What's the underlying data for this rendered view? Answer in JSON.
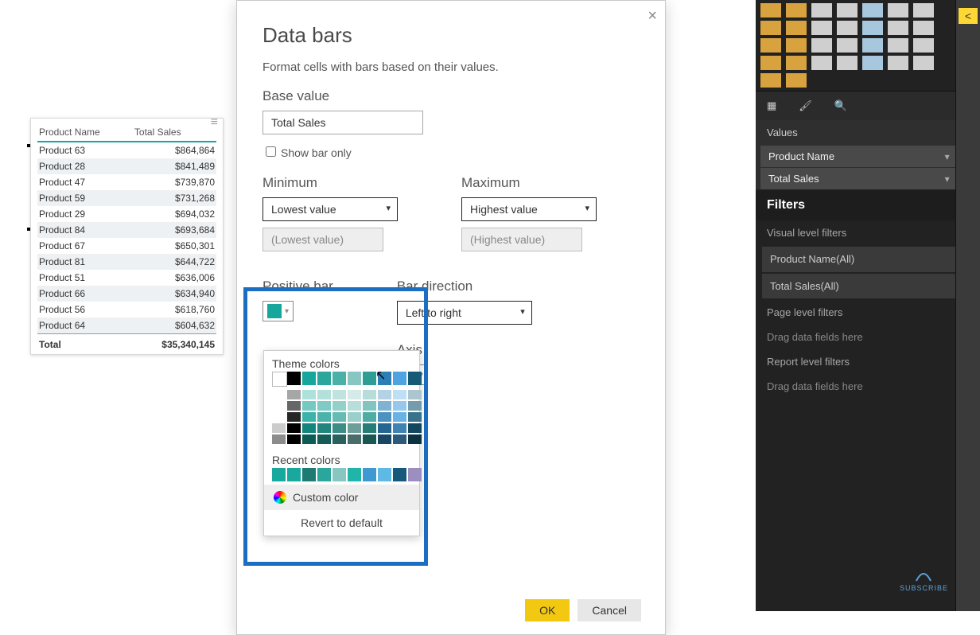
{
  "dialog": {
    "title": "Data bars",
    "subtitle": "Format cells with bars based on their values.",
    "base_value_label": "Base value",
    "base_value": "Total Sales",
    "show_bar_only": "Show bar only",
    "minimum_label": "Minimum",
    "minimum_sel": "Lowest value",
    "minimum_ph": "(Lowest value)",
    "maximum_label": "Maximum",
    "maximum_sel": "Highest value",
    "maximum_ph": "(Highest value)",
    "positive_label": "Positive bar",
    "positive_color": "#17a69b",
    "direction_label": "Bar direction",
    "direction_sel": "Left to right",
    "axis_label": "Axis",
    "axis_color": "#000000",
    "ok": "OK",
    "cancel": "Cancel"
  },
  "color_picker": {
    "theme_label": "Theme colors",
    "recent_label": "Recent colors",
    "custom": "Custom color",
    "revert": "Revert to default",
    "theme_row": [
      "#ffffff",
      "#000000",
      "#17a69b",
      "#2aa69c",
      "#4bb0a7",
      "#88c7c1",
      "#2e9e94",
      "#2b7fb5",
      "#4ea4e0",
      "#155a77"
    ],
    "recent_row": [
      "#19a89d",
      "#19a89d",
      "#1e7a72",
      "#2aa69c",
      "#88c7c1",
      "#1fb5a8",
      "#3f99d1",
      "#5fb9e5",
      "#16597a",
      "#9c8fbf"
    ]
  },
  "table": {
    "cols": [
      "Product Name",
      "Total Sales"
    ],
    "rows": [
      [
        "Product 63",
        "$864,864"
      ],
      [
        "Product 28",
        "$841,489"
      ],
      [
        "Product 47",
        "$739,870"
      ],
      [
        "Product 59",
        "$731,268"
      ],
      [
        "Product 29",
        "$694,032"
      ],
      [
        "Product 84",
        "$693,684"
      ],
      [
        "Product 67",
        "$650,301"
      ],
      [
        "Product 81",
        "$644,722"
      ],
      [
        "Product 51",
        "$636,006"
      ],
      [
        "Product 66",
        "$634,940"
      ],
      [
        "Product 56",
        "$618,760"
      ],
      [
        "Product 64",
        "$604,632"
      ]
    ],
    "total_label": "Total",
    "total_value": "$35,340,145"
  },
  "side": {
    "values_label": "Values",
    "fields": [
      "Product Name",
      "Total Sales"
    ],
    "filters_title": "Filters",
    "visual_filters": "Visual level filters",
    "vf1": "Product Name(All)",
    "vf2": "Total Sales(All)",
    "page_filters": "Page level filters",
    "report_filters": "Report level filters",
    "drag": "Drag data fields here"
  }
}
